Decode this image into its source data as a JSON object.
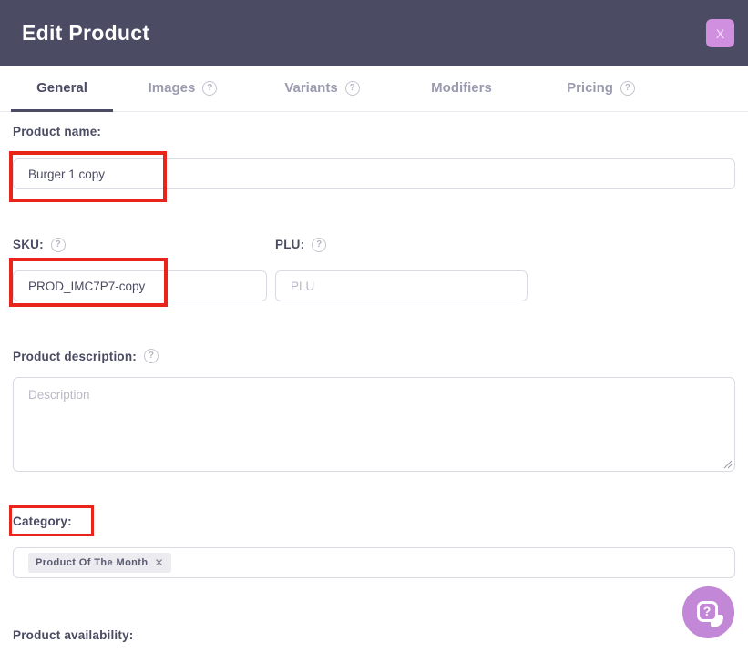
{
  "header": {
    "title": "Edit Product",
    "close_label": "X"
  },
  "tabs": [
    {
      "label": "General",
      "active": true,
      "has_help": false
    },
    {
      "label": "Images",
      "active": false,
      "has_help": true
    },
    {
      "label": "Variants",
      "active": false,
      "has_help": true
    },
    {
      "label": "Modifiers",
      "active": false,
      "has_help": false
    },
    {
      "label": "Pricing",
      "active": false,
      "has_help": true
    }
  ],
  "glyphs": {
    "help": "?",
    "chip_remove": "✕",
    "fab_question": "?"
  },
  "form": {
    "product_name": {
      "label": "Product name:",
      "value": "Burger 1 copy"
    },
    "sku": {
      "label": "SKU:",
      "value": "PROD_IMC7P7-copy",
      "has_help": true
    },
    "plu": {
      "label": "PLU:",
      "placeholder": "PLU",
      "has_help": true
    },
    "description": {
      "label": "Product description:",
      "placeholder": "Description",
      "value": "",
      "has_help": true
    },
    "category": {
      "label": "Category:",
      "selected_tags": [
        "Product Of The Month"
      ]
    },
    "availability": {
      "label": "Product availability:"
    }
  },
  "annotations": {
    "highlight_color": "#E8241B",
    "highlighted_items": [
      "product-name-input",
      "sku-input",
      "category-label"
    ]
  },
  "colors": {
    "header_bg": "#4B4B63",
    "close_button_bg": "#D18FE0",
    "active_tab": "#4B4B63",
    "inactive_tab": "#9B9BB0",
    "input_border": "#DADAE2",
    "placeholder": "#B9B9C6",
    "chip_bg": "#EBEBF0",
    "help_fab_bg": "#C287D6",
    "annotation_red": "#E8241B"
  }
}
